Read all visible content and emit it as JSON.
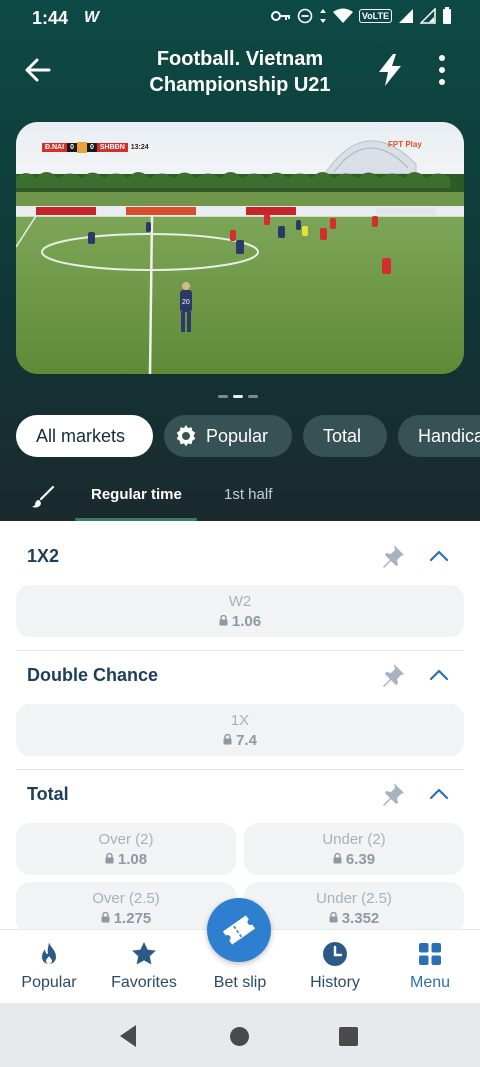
{
  "status": {
    "time": "1:44",
    "app_glyph": "W",
    "network": "VoLTE"
  },
  "header": {
    "title_line1": "Football. Vietnam",
    "title_line2": "Championship U21"
  },
  "video": {
    "home_team": "Đ.NAI",
    "home_score": "0",
    "away_score": "0",
    "away_team": "SHBĐN",
    "clock": "13:24",
    "broadcaster": "FPT Play",
    "player_number": "20"
  },
  "market_chips": [
    "All markets",
    "Popular",
    "Total",
    "Handica"
  ],
  "sub_tabs": [
    "Regular time",
    "1st half"
  ],
  "markets": [
    {
      "title": "1X2",
      "odds": [
        {
          "label": "W2",
          "value": "1.06"
        }
      ]
    },
    {
      "title": "Double Chance",
      "odds": [
        {
          "label": "1X",
          "value": "7.4"
        }
      ]
    },
    {
      "title": "Total",
      "odds": [
        {
          "label": "Over (2)",
          "value": "1.08"
        },
        {
          "label": "Under (2)",
          "value": "6.39"
        },
        {
          "label": "Over (2.5)",
          "value": "1.275"
        },
        {
          "label": "Under (2.5)",
          "value": "3.352"
        }
      ]
    }
  ],
  "bottom_nav": [
    "Popular",
    "Favorites",
    "Bet slip",
    "History",
    "Menu"
  ],
  "colors": {
    "header_bg": "#0f3d39",
    "accent_blue": "#2f7fd0",
    "active_nav": "#2b6fb6",
    "market_title": "#1d3d5c",
    "tab_underline": "#3a7d63"
  }
}
